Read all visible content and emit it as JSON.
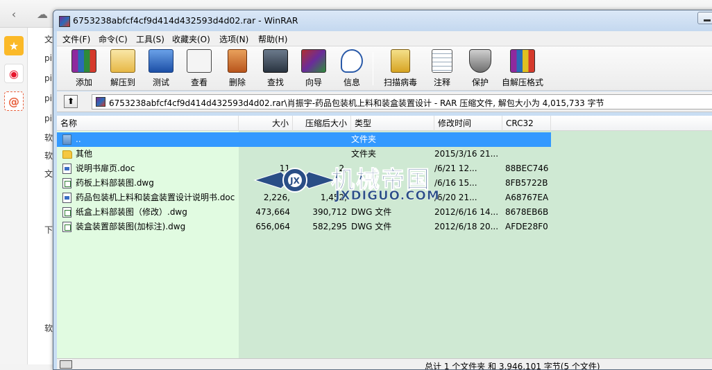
{
  "browser": {
    "back_glyph": "‹",
    "cloud_glyph": "☁",
    "side_icons": [
      "star-icon",
      "weibo-icon",
      "at-icon"
    ],
    "page_fragments": [
      "文",
      "pi",
      "pi",
      "pi",
      "pi",
      "软",
      "软",
      "文",
      "下",
      "软"
    ]
  },
  "window": {
    "title": "6753238abfcf4cf9d414d432593d4d02.rar - WinRAR"
  },
  "menu": [
    "文件(F)",
    "命令(C)",
    "工具(S)",
    "收藏夹(O)",
    "选项(N)",
    "帮助(H)"
  ],
  "toolbar": {
    "add": "添加",
    "extract_to": "解压到",
    "test": "测试",
    "view": "查看",
    "delete": "删除",
    "find": "查找",
    "wizard": "向导",
    "info": "信息",
    "virus_scan": "扫描病毒",
    "comment": "注释",
    "protect": "保护",
    "sfx": "自解压格式"
  },
  "address": {
    "up_glyph": "⬆",
    "path": "6753238abfcf4cf9d414d432593d4d02.rar\\肖振宇-药品包装机上料和装盒装置设计 - RAR 压缩文件, 解包大小为 4,015,733 字节"
  },
  "columns": {
    "name": "名称",
    "size": "大小",
    "packed": "压缩后大小",
    "type": "类型",
    "modified": "修改时间",
    "crc": "CRC32"
  },
  "files": [
    {
      "name": "..",
      "size": "",
      "packed": "",
      "type": "文件夹",
      "modified": "",
      "crc": "",
      "icon": "updir"
    },
    {
      "name": "其他",
      "size": "",
      "packed": "",
      "type": "文件夹",
      "modified": "2015/3/16 21...",
      "crc": "",
      "icon": "folder"
    },
    {
      "name": "说明书扉页.doc",
      "size": "11",
      "packed": "2,",
      "type": "",
      "modified": "/6/21 12...",
      "crc": "88BEC746",
      "icon": "doc"
    },
    {
      "name": "药板上料部装图.dwg",
      "size": "",
      "packed": "",
      "type": "",
      "modified": "/6/16 15...",
      "crc": "8FB5722B",
      "icon": "dwg"
    },
    {
      "name": "药品包装机上料和装盒装置设计说明书.doc",
      "size": "2,226,",
      "packed": "1,452,",
      "type": "",
      "modified": "/6/20 21...",
      "crc": "A68767EA",
      "icon": "doc"
    },
    {
      "name": "纸盒上料部装图（修改）.dwg",
      "size": "473,664",
      "packed": "390,712",
      "type": "DWG 文件",
      "modified": "2012/6/16 14...",
      "crc": "8678EB6B",
      "icon": "dwg"
    },
    {
      "name": "装盒装置部装图(加标注).dwg",
      "size": "656,064",
      "packed": "582,295",
      "type": "DWG 文件",
      "modified": "2012/6/18 20...",
      "crc": "AFDE28F0",
      "icon": "dwg"
    }
  ],
  "watermark": {
    "title": "机械帝国",
    "url": "JXDIGUO.COM",
    "badge": "JX"
  },
  "status": {
    "text": "总计 1 个文件夹 和 3,946,101 字节(5 个文件)"
  }
}
